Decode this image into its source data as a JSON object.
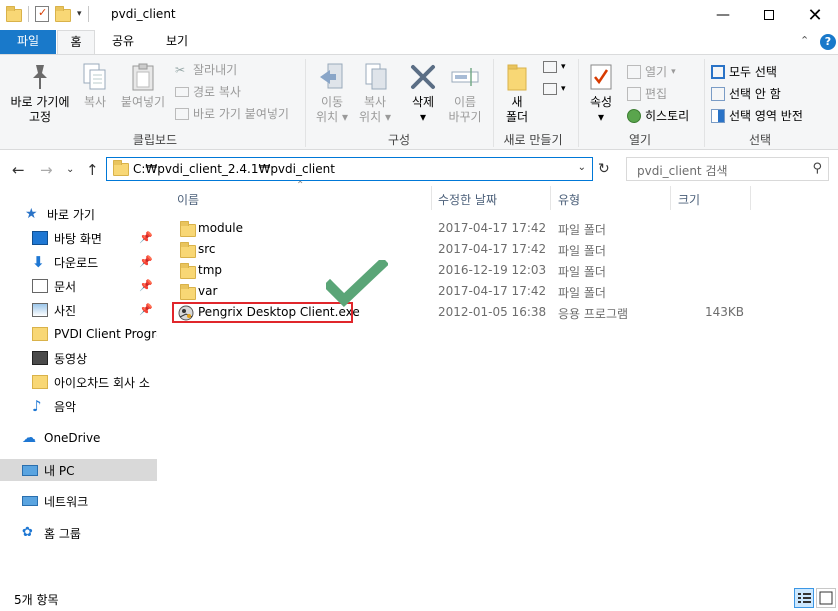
{
  "window": {
    "title": "pvdi_client"
  },
  "ribbon_tabs": [
    "파일",
    "홈",
    "공유",
    "보기"
  ],
  "clipboard": {
    "pin_label_1": "바로 가기에",
    "pin_label_2": "고정",
    "copy": "복사",
    "paste": "붙여넣기",
    "cut": "잘라내기",
    "copy_path": "경로 복사",
    "paste_shortcut": "바로 가기 붙여넣기",
    "group_label": "클립보드"
  },
  "organize": {
    "move_1": "이동",
    "move_2": "위치",
    "copy_1": "복사",
    "copy_2": "위치",
    "delete": "삭제",
    "rename_1": "이름",
    "rename_2": "바꾸기",
    "group_label": "구성"
  },
  "new_group": {
    "new_folder_1": "새",
    "new_folder_2": "폴더",
    "group_label": "새로 만들기"
  },
  "open_group": {
    "properties": "속성",
    "open": "열기",
    "edit": "편집",
    "history": "히스토리",
    "group_label": "열기"
  },
  "select_group": {
    "select_all": "모두 선택",
    "select_none": "선택 안 함",
    "invert": "선택 영역 반전",
    "group_label": "선택"
  },
  "address": {
    "path": "C:₩pvdi_client_2.4.1₩pvdi_client",
    "search_placeholder": "pvdi_client 검색"
  },
  "nav": {
    "quick_access": "바로 가기",
    "items": [
      "바탕 화면",
      "다운로드",
      "문서",
      "사진",
      "PVDI Client Program",
      "동영상",
      "아이오차드 회사 소",
      "음악"
    ],
    "onedrive": "OneDrive",
    "this_pc": "내 PC",
    "network": "네트워크",
    "homegroup": "홈 그룹"
  },
  "columns": {
    "name": "이름",
    "date": "수정한 날짜",
    "type": "유형",
    "size": "크기"
  },
  "files": [
    {
      "name": "module",
      "date": "2017-04-17 17:42",
      "type": "파일 폴더",
      "size": ""
    },
    {
      "name": "src",
      "date": "2017-04-17 17:42",
      "type": "파일 폴더",
      "size": ""
    },
    {
      "name": "tmp",
      "date": "2016-12-19 12:03",
      "type": "파일 폴더",
      "size": ""
    },
    {
      "name": "var",
      "date": "2017-04-17 17:42",
      "type": "파일 폴더",
      "size": ""
    },
    {
      "name": "Pengrix Desktop Client.exe",
      "date": "2012-01-05 16:38",
      "type": "응용 프로그램",
      "size": "143KB"
    }
  ],
  "status": {
    "item_count": "5개 항목"
  },
  "colors": {
    "accent": "#1979ca",
    "highlight": "#e0262b",
    "check": "#5aa577",
    "folder": "#f8d775"
  }
}
